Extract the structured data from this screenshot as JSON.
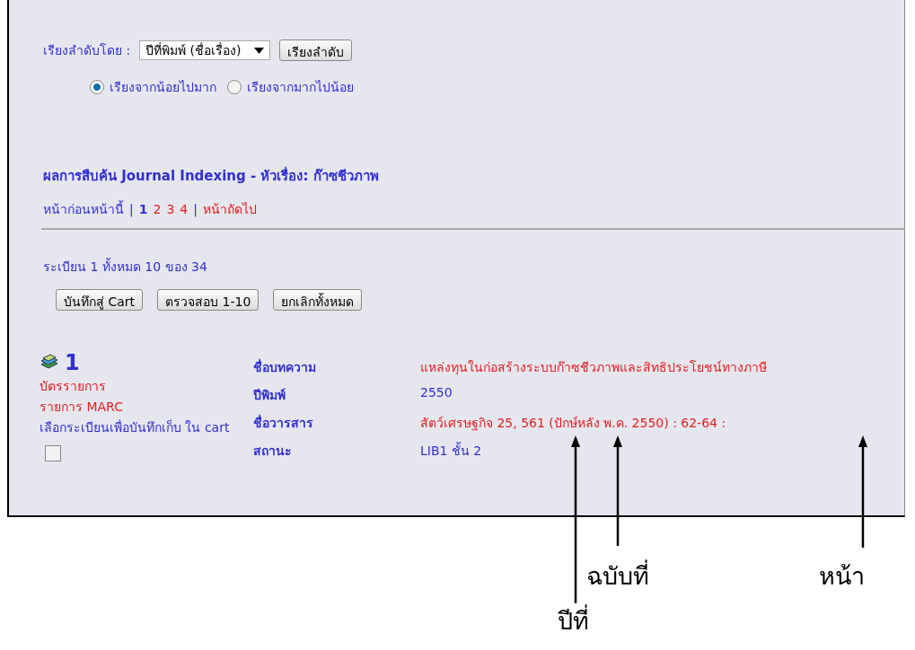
{
  "sort": {
    "label": "เรียงลำดับโดย :",
    "dropdown": "ปีที่พิมพ์ (ชื่อเรื่อง)",
    "button": "เรียงลำดับ",
    "radios": [
      {
        "label": "เรียงจากน้อยไปมาก",
        "selected": true
      },
      {
        "label": "เรียงจากมากไปน้อย",
        "selected": false
      }
    ]
  },
  "results": {
    "title": "ผลการสืบค้น Journal Indexing - หัวเรื่อง: ก๊าซชีวภาพ",
    "pager": {
      "previous": "หน้าก่อนหน้านี้",
      "separator": "|",
      "pages": [
        {
          "label": "1",
          "selected": true
        },
        {
          "label": "2",
          "selected": false
        },
        {
          "label": "3",
          "selected": false
        },
        {
          "label": "4",
          "selected": false
        }
      ],
      "next": "หน้าถัดไป"
    },
    "summary": "ระเบียน 1 ทั้งหมด 10 ของ 34",
    "buttons": [
      "บันทึกสู่ Cart",
      "ตรวจสอบ 1-10",
      "ยกเลิกทั้งหมด"
    ]
  },
  "record": {
    "number": "1",
    "links": [
      "บัตรรายการ",
      "รายการ MARC"
    ],
    "cart_label": "เลือกระเบียนเพื่อบันทึกเก็บ ใน cart",
    "checked": false,
    "fields": [
      {
        "label": "ชื่อบทความ",
        "value": "แหล่งทุนในก่อสร้างระบบก๊าซชีวภาพและสิทธิประโยชน์ทางภาษี",
        "color": "#e02020"
      },
      {
        "label": "ปีพิมพ์",
        "value": "2550",
        "color": "#3030d0"
      },
      {
        "label": "ชื่อวารสาร",
        "value": "สัตว์เศรษฐกิจ 25, 561 (ปักษ์หลัง พ.ค. 2550) : 62-64 :",
        "color": "#e02020"
      },
      {
        "label": "สถานะ",
        "value": "LIB1 ชั้น 2",
        "color": "#3030d0"
      }
    ]
  },
  "annotations": [
    {
      "label": "ฉบับที่"
    },
    {
      "label": "หน้า"
    },
    {
      "label": "ปีที่"
    }
  ]
}
